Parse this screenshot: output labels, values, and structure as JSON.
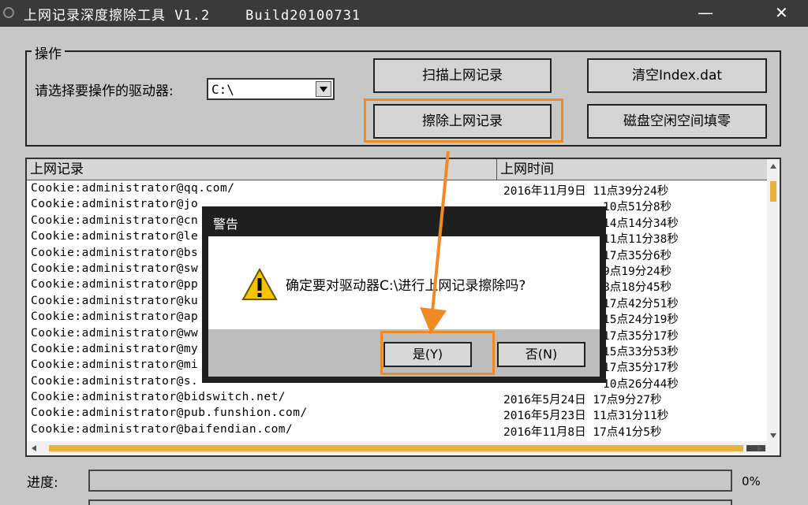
{
  "window": {
    "title": "上网记录深度擦除工具 V1.2    Build20100731",
    "minimize": "—",
    "close": "✕"
  },
  "operations": {
    "group_title": "操作",
    "drive_label": "请选择要操作的驱动器:",
    "drive_value": "C:\\",
    "scan_button": "扫描上网记录",
    "clear_index_button": "清空Index.dat",
    "erase_button": "擦除上网记录",
    "fill_free_button": "磁盘空闲空间填零"
  },
  "list": {
    "columns": [
      "上网记录",
      "上网时间"
    ],
    "rows": [
      [
        "Cookie:administrator@qq.com/",
        "2016年11月9日  11点39分24秒"
      ],
      [
        "Cookie:administrator@jo",
        "10点51分8秒"
      ],
      [
        "Cookie:administrator@cn",
        "14点14分34秒"
      ],
      [
        "Cookie:administrator@le",
        "11点11分38秒"
      ],
      [
        "Cookie:administrator@bs",
        "17点35分6秒"
      ],
      [
        "Cookie:administrator@sw",
        "9点19分24秒"
      ],
      [
        "Cookie:administrator@pp",
        "8点18分45秒"
      ],
      [
        "Cookie:administrator@ku",
        "17点42分51秒"
      ],
      [
        "Cookie:administrator@ap",
        "15点24分19秒"
      ],
      [
        "Cookie:administrator@ww",
        "17点35分17秒"
      ],
      [
        "Cookie:administrator@my",
        "15点33分53秒"
      ],
      [
        "Cookie:administrator@mi",
        "17点35分17秒"
      ],
      [
        "Cookie:administrator@s.",
        "10点26分44秒"
      ],
      [
        "Cookie:administrator@bidswitch.net/",
        "2016年5月24日  17点9分27秒"
      ],
      [
        "Cookie:administrator@pub.funshion.com/",
        "2016年5月23日  11点31分11秒"
      ],
      [
        "Cookie:administrator@baifendian.com/",
        "2016年11月8日  17点41分5秒"
      ]
    ]
  },
  "progress": {
    "label": "进度:",
    "value_text": "0%",
    "fraction": 0
  },
  "dialog": {
    "title": "警告",
    "message": "确定要对驱动器C:\\进行上网记录擦除吗?",
    "yes_button": "是(Y)",
    "no_button": "否(N)"
  },
  "colors": {
    "highlight": "#f08a24",
    "scroll_thumb": "#e8b23a",
    "titlebar": "#3a3a3a"
  }
}
